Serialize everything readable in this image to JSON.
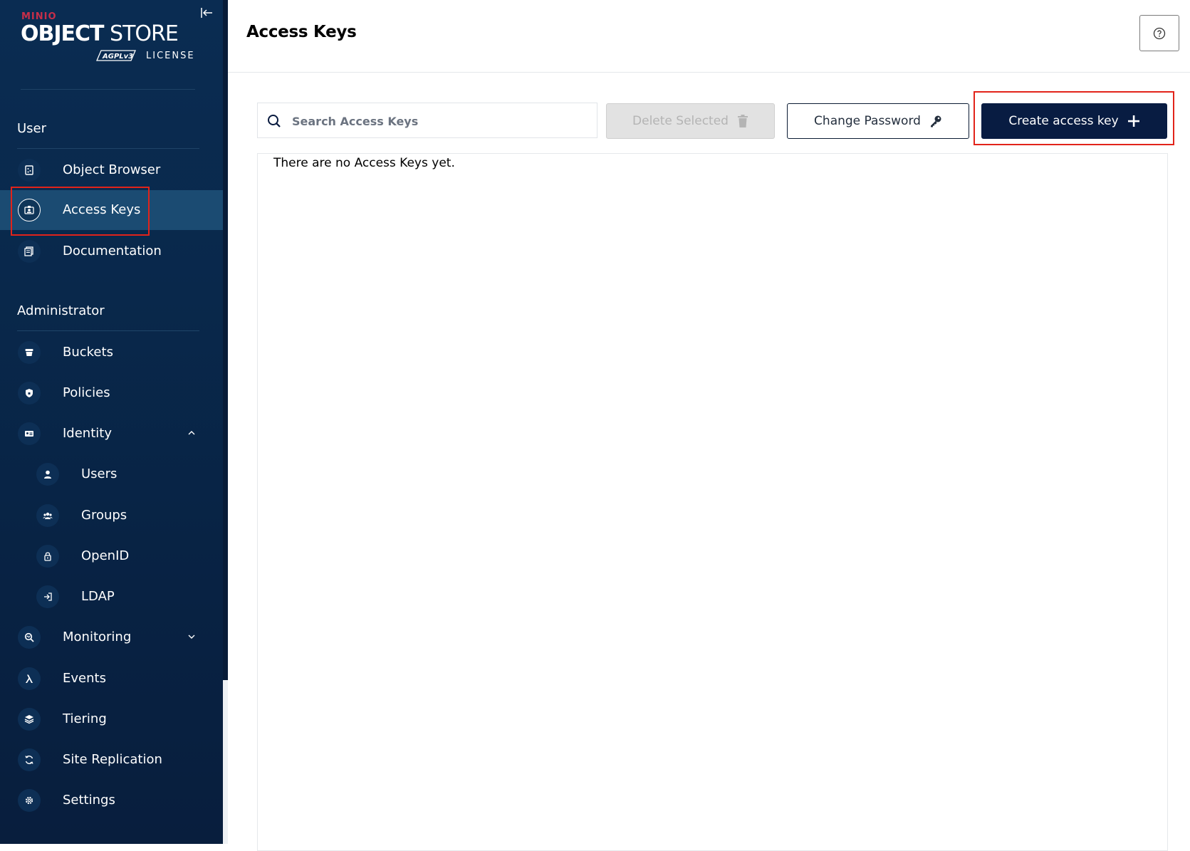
{
  "sidebar": {
    "logo": {
      "brand": "MINIO",
      "product_bold": "OBJECT",
      "product_light": " STORE",
      "license": "LICENSE",
      "license_badge": "AGPLv3"
    },
    "user_section": {
      "label": "User",
      "items": [
        {
          "label": "Object Browser",
          "icon": "object-browser-icon"
        },
        {
          "label": "Access Keys",
          "icon": "access-keys-icon",
          "active": true
        },
        {
          "label": "Documentation",
          "icon": "documentation-icon"
        }
      ]
    },
    "admin_section": {
      "label": "Administrator",
      "items": [
        {
          "label": "Buckets",
          "icon": "buckets-icon"
        },
        {
          "label": "Policies",
          "icon": "policies-icon"
        },
        {
          "label": "Identity",
          "icon": "identity-icon",
          "expanded": true,
          "children": [
            {
              "label": "Users",
              "icon": "users-icon"
            },
            {
              "label": "Groups",
              "icon": "groups-icon"
            },
            {
              "label": "OpenID",
              "icon": "openid-icon"
            },
            {
              "label": "LDAP",
              "icon": "ldap-icon"
            }
          ]
        },
        {
          "label": "Monitoring",
          "icon": "monitoring-icon",
          "expanded": false
        },
        {
          "label": "Events",
          "icon": "events-icon"
        },
        {
          "label": "Tiering",
          "icon": "tiering-icon"
        },
        {
          "label": "Site Replication",
          "icon": "site-replication-icon"
        },
        {
          "label": "Settings",
          "icon": "settings-icon"
        }
      ]
    }
  },
  "header": {
    "title": "Access Keys"
  },
  "toolbar": {
    "search": {
      "placeholder": "Search Access Keys",
      "value": ""
    },
    "delete_label": "Delete Selected",
    "change_password_label": "Change Password",
    "create_label": "Create access key"
  },
  "list": {
    "empty_message": "There are no Access Keys yet."
  },
  "colors": {
    "sidebar_bg": "#0a2c52",
    "active_item": "#1b4b72",
    "primary_button": "#081c42",
    "highlight": "#e2231a",
    "brand_red": "#c72e49"
  }
}
